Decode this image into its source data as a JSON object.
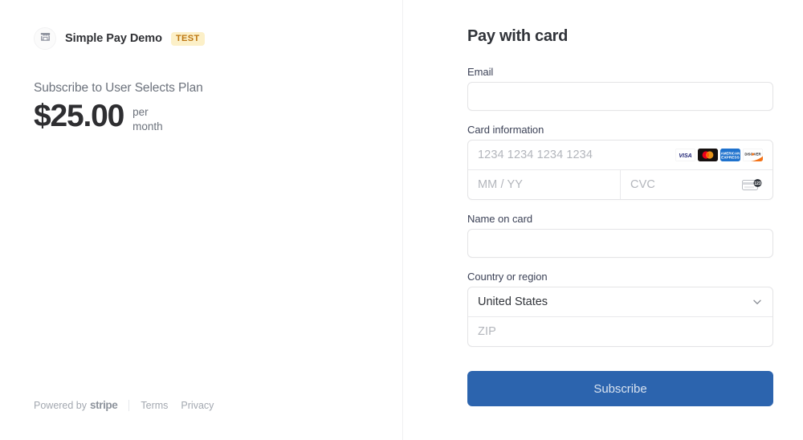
{
  "summary": {
    "merchant": {
      "icon": "storefront-icon",
      "name": "Simple Pay Demo",
      "badge": "TEST"
    },
    "plan_line": "Subscribe to User Selects Plan",
    "price": "$25.00",
    "interval": "per month",
    "footer": {
      "powered_by_prefix": "Powered by",
      "powered_by_brand": "stripe",
      "terms": "Terms",
      "privacy": "Privacy"
    }
  },
  "payment": {
    "title": "Pay with card",
    "email": {
      "label": "Email",
      "value": "",
      "placeholder": ""
    },
    "card": {
      "label": "Card information",
      "number_placeholder": "1234 1234 1234 1234",
      "number_value": "",
      "expiry_placeholder": "MM / YY",
      "expiry_value": "",
      "cvc_placeholder": "CVC",
      "cvc_value": "",
      "brands": [
        "visa-icon",
        "mastercard-icon",
        "amex-icon",
        "discover-icon"
      ],
      "cvc_hint_icon": "cvc-card-icon"
    },
    "name_on_card": {
      "label": "Name on card",
      "value": "",
      "placeholder": ""
    },
    "country": {
      "label": "Country or region",
      "selected": "United States",
      "zip_placeholder": "ZIP",
      "zip_value": "",
      "chevron_icon": "chevron-down-icon"
    },
    "submit_label": "Subscribe"
  },
  "colors": {
    "accent": "#2c64ae",
    "badge_bg": "#fcf0c8",
    "badge_text": "#bd7712",
    "border": "#e4e4e6",
    "label_text": "#3c4257",
    "muted_text": "#6c727c"
  }
}
